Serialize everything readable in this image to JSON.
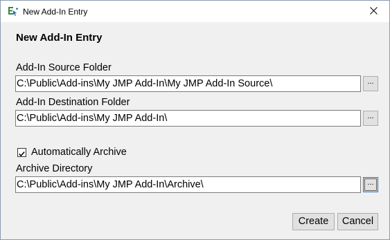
{
  "window": {
    "title": "New Add-In Entry"
  },
  "dialog": {
    "heading": "New Add-In Entry",
    "source_folder": {
      "label": "Add-In Source Folder",
      "value": "C:\\Public\\Add-ins\\My JMP Add-In\\My JMP Add-In Source\\",
      "browse_label": "..."
    },
    "destination_folder": {
      "label": "Add-In Destination Folder",
      "value": "C:\\Public\\Add-ins\\My JMP Add-In\\",
      "browse_label": "..."
    },
    "auto_archive": {
      "label": "Automatically Archive",
      "checked": true
    },
    "archive_directory": {
      "label": "Archive Directory",
      "value": "C:\\Public\\Add-ins\\My JMP Add-In\\Archive\\",
      "browse_label": "..."
    },
    "buttons": {
      "create": "Create",
      "cancel": "Cancel"
    }
  },
  "icons": {
    "app": "jmp-addin-icon",
    "close": "close-icon",
    "check": "checkmark-icon"
  },
  "colors": {
    "dialog_bg": "#f0f0f0",
    "titlebar_bg": "#ffffff",
    "button_bg": "#e1e1e1",
    "focus_border": "#2b72c9",
    "icon_green": "#2e8b3e",
    "icon_blue": "#2b6cb0"
  }
}
